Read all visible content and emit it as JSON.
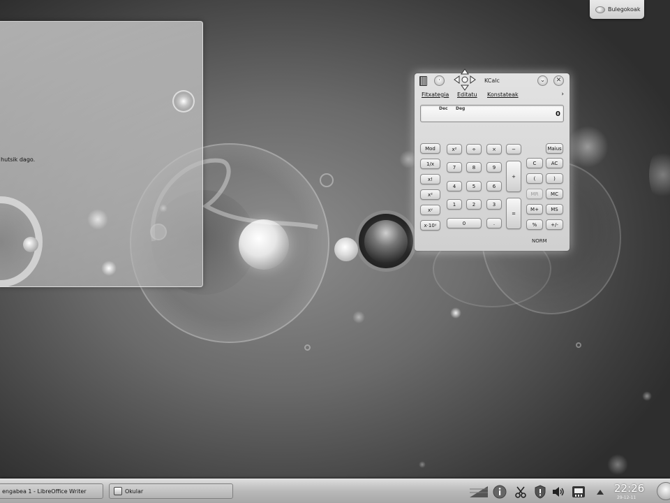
{
  "activity": {
    "label": "Bulegokoak",
    "icon": "activity-icon"
  },
  "background_window": {
    "text": "hutsik dago."
  },
  "kcalc": {
    "title": "KCalc",
    "menu": [
      "Fitxategia",
      "Editatu",
      "Konstateak"
    ],
    "menu_more": "›",
    "display": {
      "base_label": "Dec",
      "angle_label": "Deg",
      "value": "0"
    },
    "buttons": {
      "mod": "Mod",
      "inverse": "1/x",
      "factorial": "x!",
      "square": "x²",
      "power": "xʸ",
      "exp10": "x·10ʸ",
      "x_sq": "x²",
      "divide": "÷",
      "multiply": "×",
      "minus": "−",
      "seven": "7",
      "eight": "8",
      "nine": "9",
      "four": "4",
      "five": "5",
      "six": "6",
      "one": "1",
      "two": "2",
      "three": "3",
      "zero": "0",
      "dot": ".",
      "plus": "+",
      "equals": "=",
      "shift": "Maius",
      "clear": "C",
      "all_clear": "AC",
      "paren_open": "(",
      "paren_close": ")",
      "mr": "MR",
      "mc": "MC",
      "m_plus": "M+",
      "ms": "MS",
      "percent": "%",
      "plus_minus": "+/-"
    },
    "mode_label": "NORM"
  },
  "taskbar": {
    "tasks": [
      "engabea 1 - LibreOffice Writer",
      "Okular"
    ],
    "clock_time": "22:26",
    "clock_date": "29-12-11"
  },
  "colors": {
    "taskbar": "#b9b9b9",
    "window": "#d6d6d6"
  }
}
